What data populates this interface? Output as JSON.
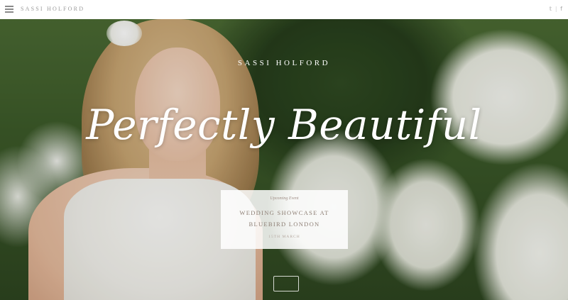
{
  "header": {
    "brand": "SASSI HOLFORD",
    "social": {
      "twitter_icon": "twitter-icon",
      "facebook_icon": "facebook-icon",
      "twitter_glyph": "𝕥",
      "facebook_glyph": "f",
      "separator": "|"
    }
  },
  "hero": {
    "brand": "SASSI HOLFORD",
    "headline": "Perfectly Beautiful",
    "event": {
      "kicker": "Upcoming Event",
      "title_line1": "WEDDING SHOWCASE AT",
      "title_line2": "BLUEBIRD LONDON",
      "date": "15TH MARCH"
    }
  },
  "colors": {
    "header_bg": "#ffffff",
    "header_text": "#9a9a9a",
    "hero_text": "#ffffff",
    "card_bg": "#ffffff",
    "card_text": "#8c7d73"
  }
}
